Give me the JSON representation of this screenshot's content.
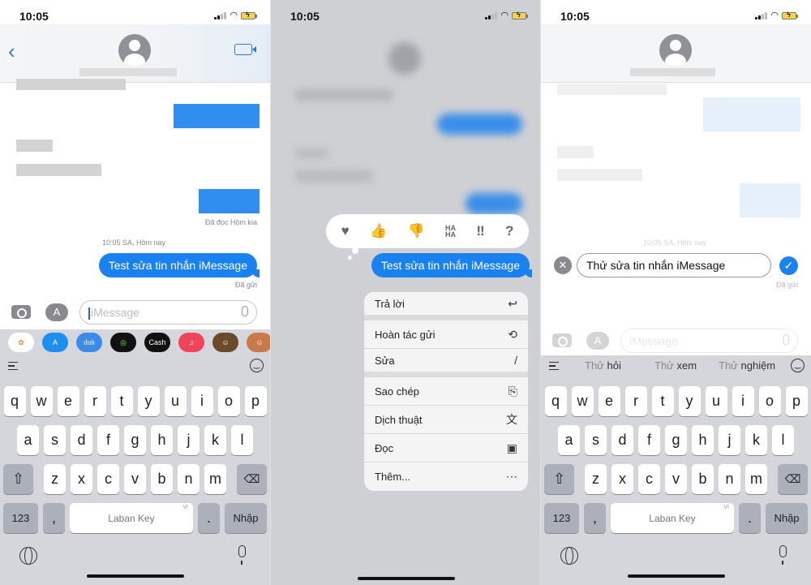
{
  "status_bar": {
    "time": "10:05"
  },
  "panel1": {
    "read_receipt": "Đã đọc Hôm kia",
    "timestamp": "10:05 SA, Hôm nay",
    "message": "Test sửa tin nhắn iMessage",
    "sent_status": "Đã gửi",
    "input_placeholder": "iMessage",
    "app_drawer": [
      {
        "name": "photos",
        "label": "",
        "color": "#ffffff"
      },
      {
        "name": "app-store",
        "label": "A",
        "color": "#1e8ff0"
      },
      {
        "name": "audio",
        "label": "ılı",
        "color": "#3a8ce8"
      },
      {
        "name": "activity",
        "label": "◎",
        "color": "#111111"
      },
      {
        "name": "apple-cash",
        "label": "Cash",
        "color": "#111111"
      },
      {
        "name": "music",
        "label": "♫",
        "color": "#f0445a"
      },
      {
        "name": "memoji",
        "label": "☺",
        "color": "#6b4a2a"
      }
    ]
  },
  "panel2": {
    "message": "Test sửa tin nhắn iMessage",
    "reactions": [
      "heart",
      "thumbs-up",
      "thumbs-down",
      "haha",
      "exclamation",
      "question"
    ],
    "reaction_glyphs": [
      "♥",
      "👍",
      "👎",
      "HA HA",
      "‼",
      "?"
    ],
    "menu": [
      {
        "label": "Trả lời",
        "icon": "reply-icon",
        "glyph": "↩"
      },
      {
        "label": "Hoàn tác gửi",
        "icon": "undo-icon",
        "glyph": "⟲"
      },
      {
        "label": "Sửa",
        "icon": "pencil-icon",
        "glyph": "/"
      },
      {
        "label": "Sao chép",
        "icon": "copy-icon",
        "glyph": "⎘"
      },
      {
        "label": "Dịch thuật",
        "icon": "translate-icon",
        "glyph": "文"
      },
      {
        "label": "Đọc",
        "icon": "speak-icon",
        "glyph": "▣"
      },
      {
        "label": "Thêm...",
        "icon": "more-icon",
        "glyph": "⋯"
      }
    ]
  },
  "panel3": {
    "timestamp": "10:05 SA, Hôm nay",
    "edit_value": "Thử sửa tin nhắn iMessage",
    "sent_status": "Đã gửi",
    "input_placeholder": "iMessage",
    "suggestions": [
      {
        "prefix": "Thử ",
        "word": "hỏi"
      },
      {
        "prefix": "Thử ",
        "word": "xem"
      },
      {
        "prefix": "Thử ",
        "word": "nghiệm"
      }
    ]
  },
  "keyboard": {
    "row1": [
      "q",
      "w",
      "e",
      "r",
      "t",
      "y",
      "u",
      "i",
      "o",
      "p"
    ],
    "row2": [
      "a",
      "s",
      "d",
      "f",
      "g",
      "h",
      "j",
      "k",
      "l"
    ],
    "row3": [
      "z",
      "x",
      "c",
      "v",
      "b",
      "n",
      "m"
    ],
    "numbers_label": "123",
    "comma": ",",
    "space_label": "Laban Key",
    "space_lang": "VI",
    "period": ".",
    "enter_label": "Nhập"
  }
}
